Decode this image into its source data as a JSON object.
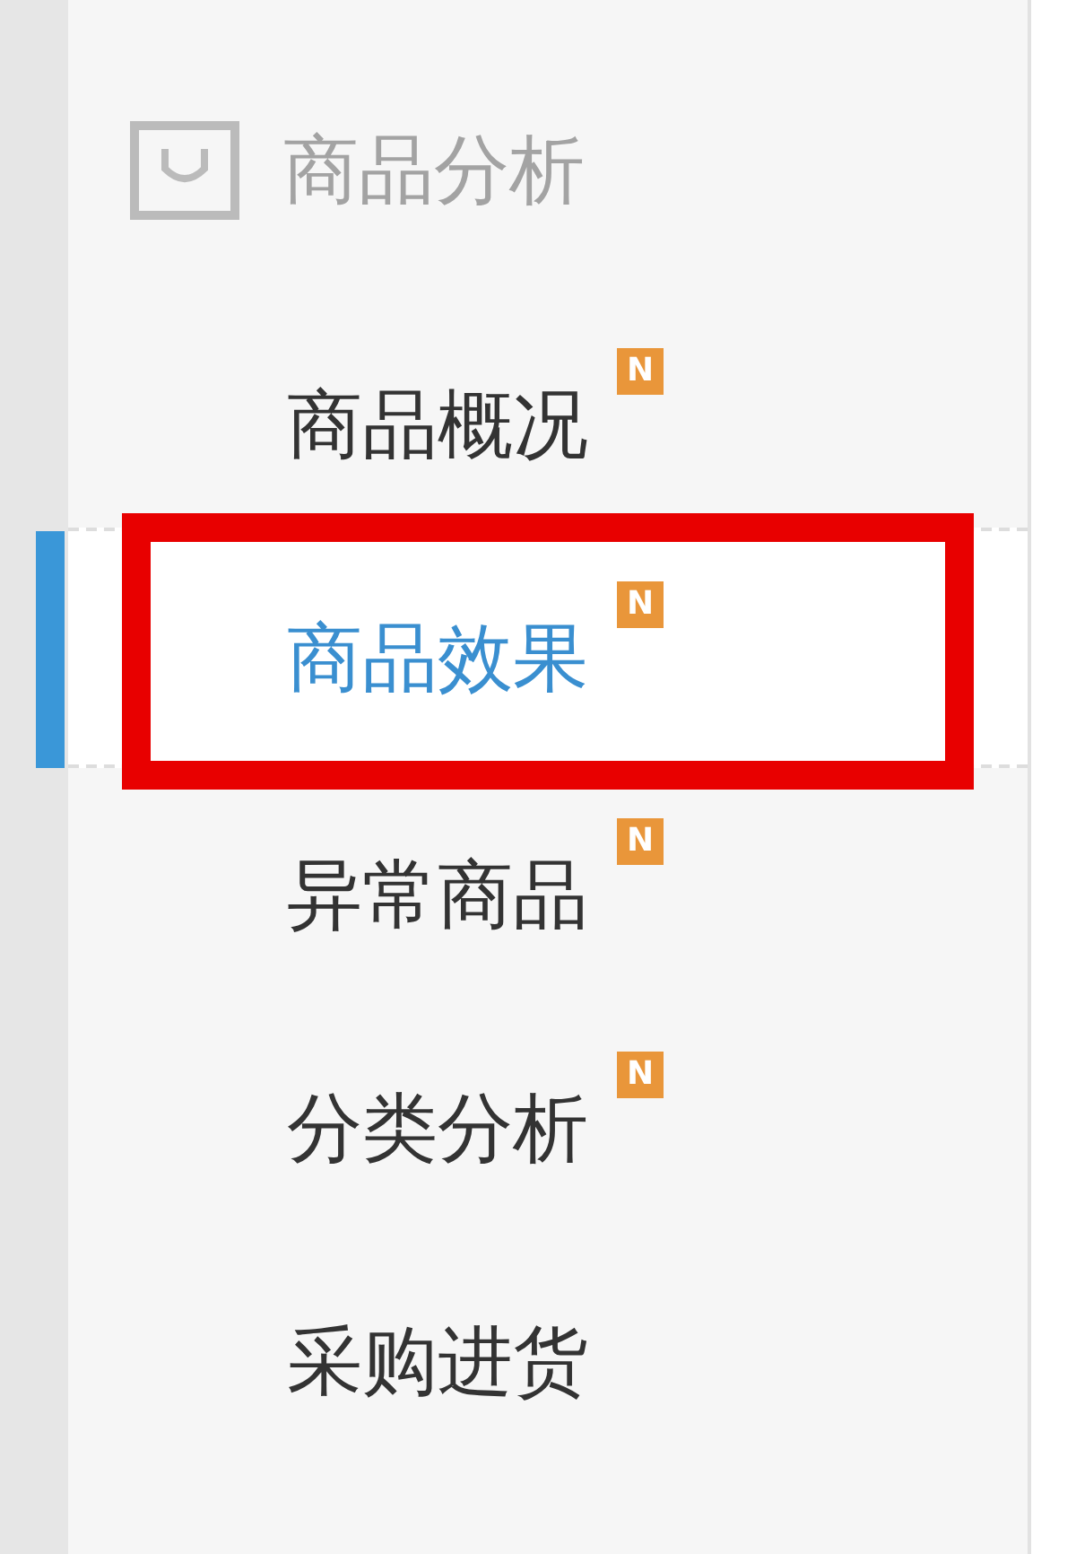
{
  "section": {
    "title": "商品分析"
  },
  "items": [
    {
      "label": "商品概况",
      "badge": "N",
      "selected": false,
      "highlighted": false
    },
    {
      "label": "商品效果",
      "badge": "N",
      "selected": true,
      "highlighted": true
    },
    {
      "label": "异常商品",
      "badge": "N",
      "selected": false,
      "highlighted": false
    },
    {
      "label": "分类分析",
      "badge": "N",
      "selected": false,
      "highlighted": false
    },
    {
      "label": "采购进货",
      "selected": false,
      "highlighted": false
    }
  ]
}
